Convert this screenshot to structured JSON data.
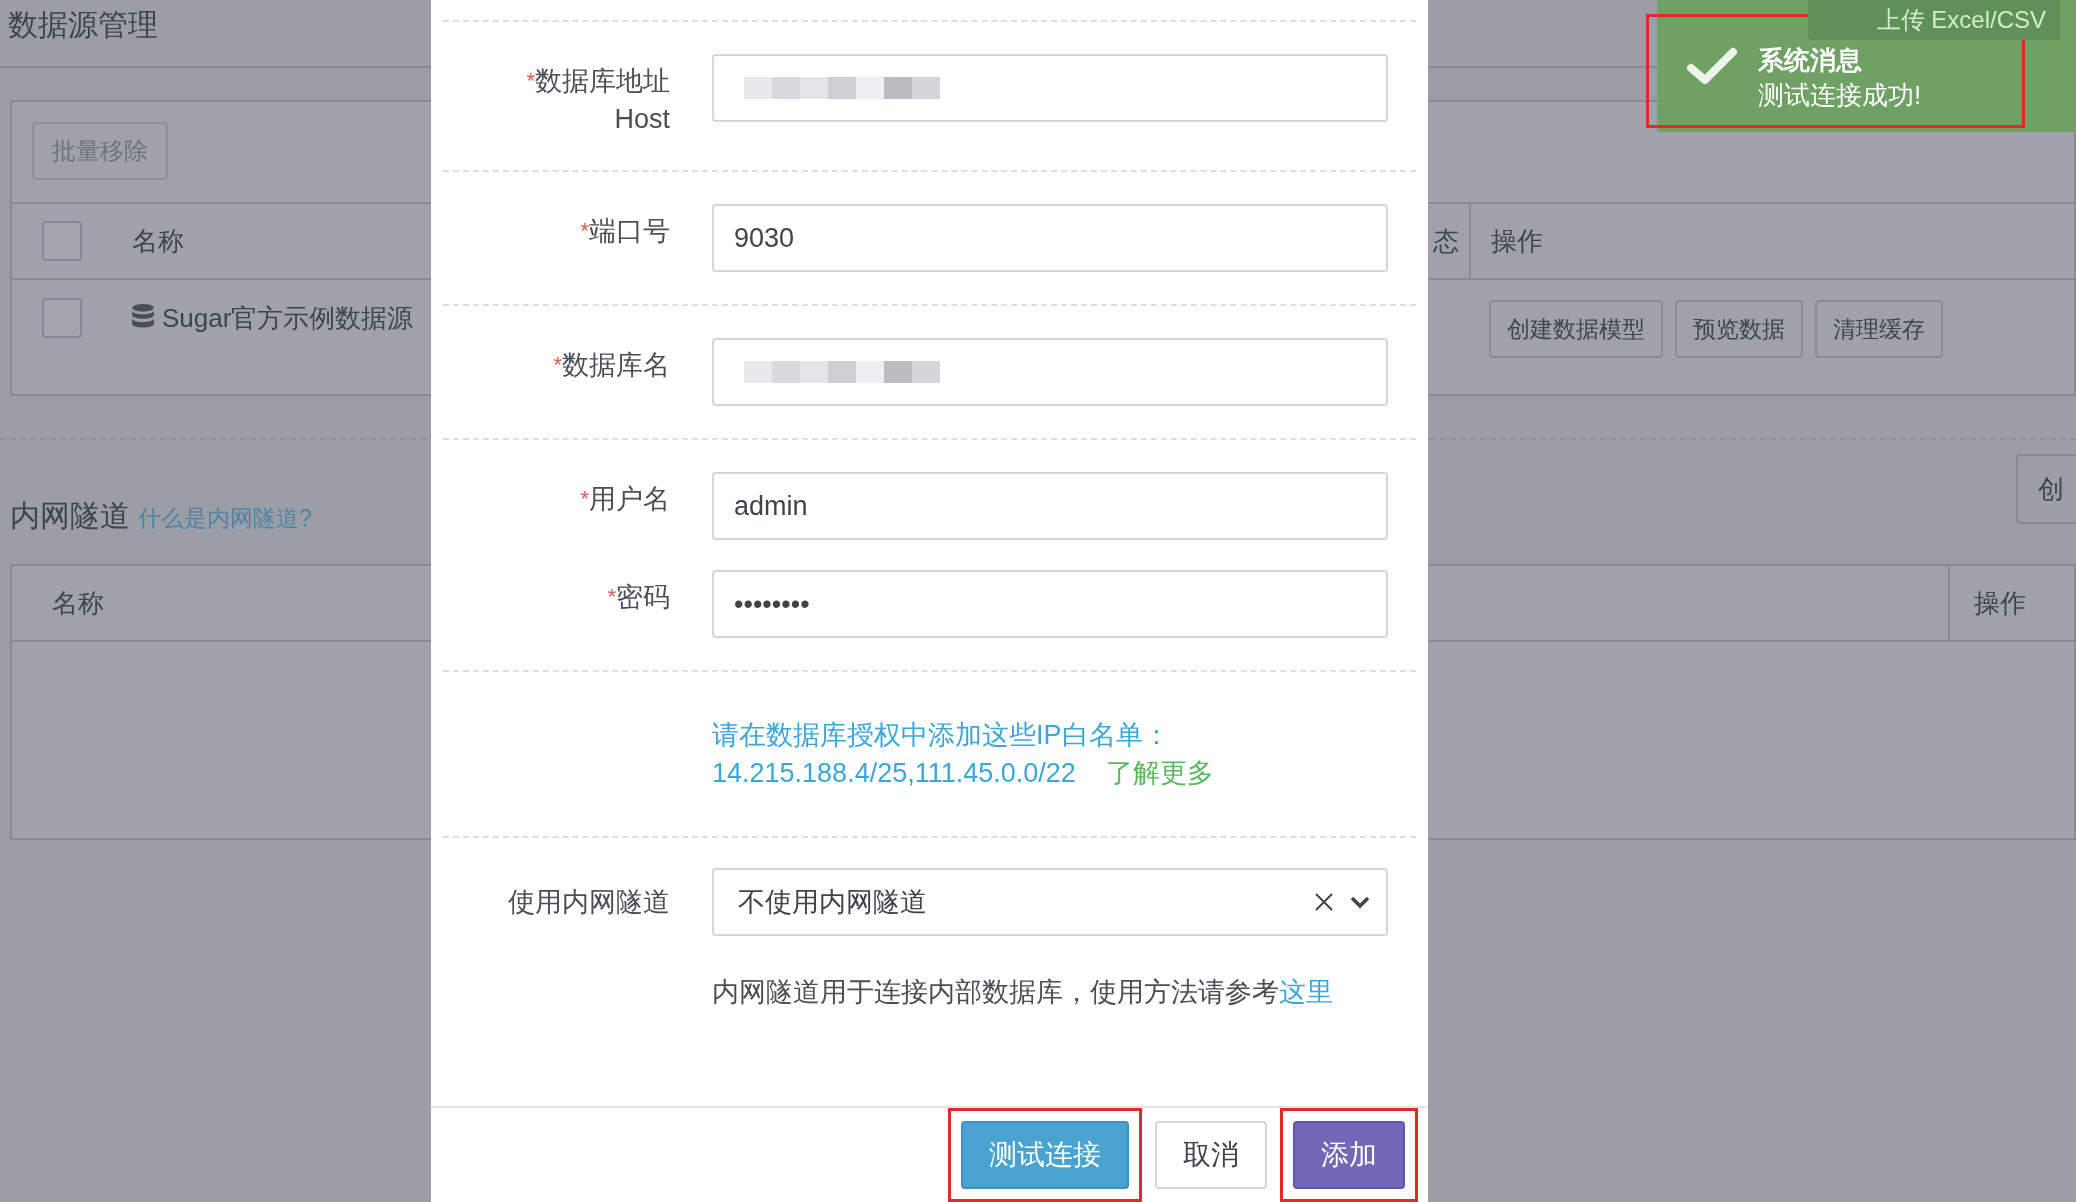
{
  "page": {
    "title": "数据源管理",
    "bulk_remove": "批量移除",
    "upload_button": "上传 Excel/CSV",
    "datasource_table": {
      "header_checked": false,
      "columns": [
        "名称",
        "态",
        "操作"
      ],
      "rows": [
        {
          "name": "Sugar官方示例数据源",
          "checked": false,
          "actions": [
            "创建数据模型",
            "预览数据",
            "清理缓存"
          ]
        }
      ]
    },
    "tunnel_section": {
      "title": "内网隧道",
      "help_link": "什么是内网隧道?",
      "create_button": "创",
      "columns": [
        "名称",
        "操作"
      ]
    }
  },
  "dialog": {
    "sections": [
      {
        "kind": "fields",
        "fields": [
          {
            "label": "数据库地址",
            "sublabel": "Host",
            "required_mark": "*",
            "kind": "redacted"
          }
        ]
      },
      {
        "kind": "fields",
        "fields": [
          {
            "label": "端口号",
            "required_mark": "*",
            "kind": "text",
            "value": "9030"
          }
        ]
      },
      {
        "kind": "fields",
        "fields": [
          {
            "label": "数据库名",
            "required_mark": "*",
            "kind": "redacted"
          }
        ]
      },
      {
        "kind": "fields",
        "fields": [
          {
            "label": "用户名",
            "required_mark": "*",
            "kind": "text",
            "value": "admin"
          },
          {
            "label": "密码",
            "required_mark": "*",
            "kind": "text",
            "value": "••••••••"
          }
        ]
      },
      {
        "kind": "notice",
        "text": "请在数据库授权中添加这些IP白名单：",
        "ips": "14.215.188.4/25,111.45.0.0/22",
        "link": "了解更多"
      },
      {
        "kind": "tunnel",
        "label": "使用内网隧道",
        "value": "不使用内网隧道",
        "hint": "内网隧道用于连接内部数据库，使用方法请参考",
        "hint_link": "这里"
      }
    ],
    "buttons": [
      {
        "label": "测试连接",
        "kind": "info",
        "highlighted": true
      },
      {
        "label": "取消",
        "kind": "default",
        "highlighted": false
      },
      {
        "label": "添加",
        "kind": "primary",
        "highlighted": true
      }
    ]
  },
  "toast": {
    "title": "系统消息",
    "message": "测试连接成功!",
    "highlighted": true
  }
}
